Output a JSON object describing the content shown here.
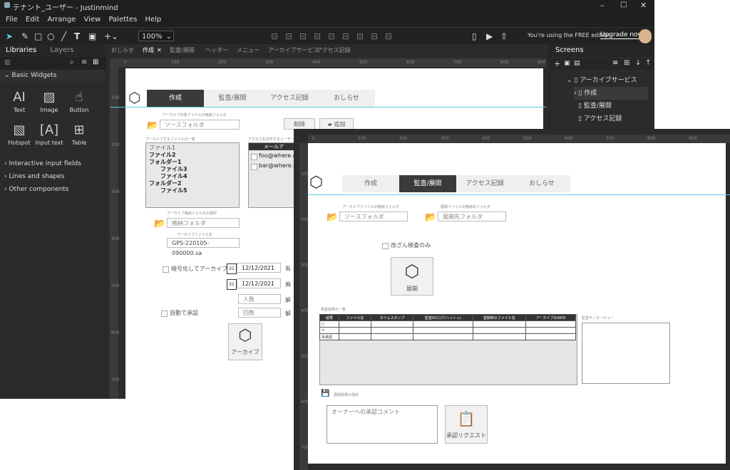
{
  "window1": {
    "title": "テナント_ユーザー - Justinmind",
    "menu": [
      "File",
      "Edit",
      "Arrange",
      "View",
      "Palettes",
      "Help"
    ],
    "zoom": "100%",
    "free_edition": "You're using the FREE edition",
    "upgrade": "Upgrade now",
    "left_tabs": [
      "Libraries",
      "Layers"
    ],
    "basic_widgets": "Basic Widgets",
    "widgets": [
      "Text",
      "Image",
      "Button",
      "Hotspot",
      "Input text",
      "Table"
    ],
    "sections": [
      "Interactive input fields",
      "Lines and shapes",
      "Other components"
    ],
    "doc_tabs": [
      "おしらせ",
      "作成",
      "監査/展開",
      "ヘッダー",
      "メニュー",
      "アーカイブサービス",
      "アクセス記録"
    ],
    "screens_title": "Screens",
    "screens": [
      "アーカイブサービス",
      "作成",
      "監査/展開",
      "アクセス記録"
    ],
    "ruler_top": [
      "0",
      "100",
      "200",
      "300",
      "400",
      "500",
      "600",
      "700",
      "800",
      "900"
    ],
    "ruler_left": [
      "100",
      "200",
      "300",
      "400",
      "500",
      "600",
      "700"
    ]
  },
  "create_screen": {
    "tabs": [
      "作成",
      "監査/展開",
      "アクセス記録",
      "おしらせ"
    ],
    "src_folder_label": "アーカイブ対象ファイルの格納フォルダ",
    "src_folder": "ソースフォルダ",
    "delete": "削除",
    "add": "追加",
    "files_label": "アーカイブするファイルの一覧",
    "tree": [
      "ファイル1",
      "ファイル2",
      "フォルダー1",
      "ファイル3",
      "ファイル4",
      "フォルダー2",
      "ファイル5"
    ],
    "users_label": "アクセスを許可するユーザー",
    "mail_header": "メールア",
    "mails": [
      "foo@where.c",
      "bar@where.c"
    ],
    "dest_folder_label": "アーカイブ格納フォルダの選択",
    "dest_folder": "格納フォルダ",
    "archive_name_label": "アーカイブファイル名",
    "archive_name": "GPS-220105-090000.sa",
    "encrypt": "暗号化してアーカイブ",
    "date1": "12/12/2021",
    "date2": "12/12/2021",
    "valid": "有",
    "expire": "廃",
    "count": "人数",
    "times": "回数",
    "count_unit": "解",
    "times_unit": "解",
    "auto_approve": "自動で承認",
    "archive_btn": "アーカイブ",
    "cal": "31"
  },
  "audit_screen": {
    "tabs": [
      "作成",
      "監査/展開",
      "アクセス記録",
      "おしらせ"
    ],
    "archive_folder_label": "アーカイブファイルの格納フォルダ",
    "archive_folder": "ソースフォルダ",
    "expand_folder_label": "展開ファイルの格納先フォルダ",
    "expand_folder": "展開先フォルダ",
    "inspect_only": "改ざん検査のみ",
    "expand_btn": "展開",
    "results_label": "検査結果の一覧",
    "columns": [
      "結果",
      "ファイル名",
      "タイムスタンプ",
      "監査ID(ログ/ハッシュ)",
      "登録時のファイル名",
      "アーカイブのAKID"
    ],
    "rows": [
      "○",
      "×",
      "未承認"
    ],
    "monitor_label": "監査モニタービュー",
    "save_label": "展開結果の保存",
    "comment_placeholder": "オーナーへの承認コメント",
    "request_btn": "承認リクエスト",
    "ruler_top": [
      "0",
      "100",
      "200",
      "300",
      "400",
      "500",
      "600",
      "700",
      "800",
      "900"
    ],
    "ruler_left": [
      "100",
      "200",
      "300",
      "400",
      "500",
      "600",
      "700"
    ]
  },
  "colors": {
    "dark": "#2b2b2b",
    "accent": "#5ec8e6",
    "tab_active": "#3a3a3a"
  }
}
